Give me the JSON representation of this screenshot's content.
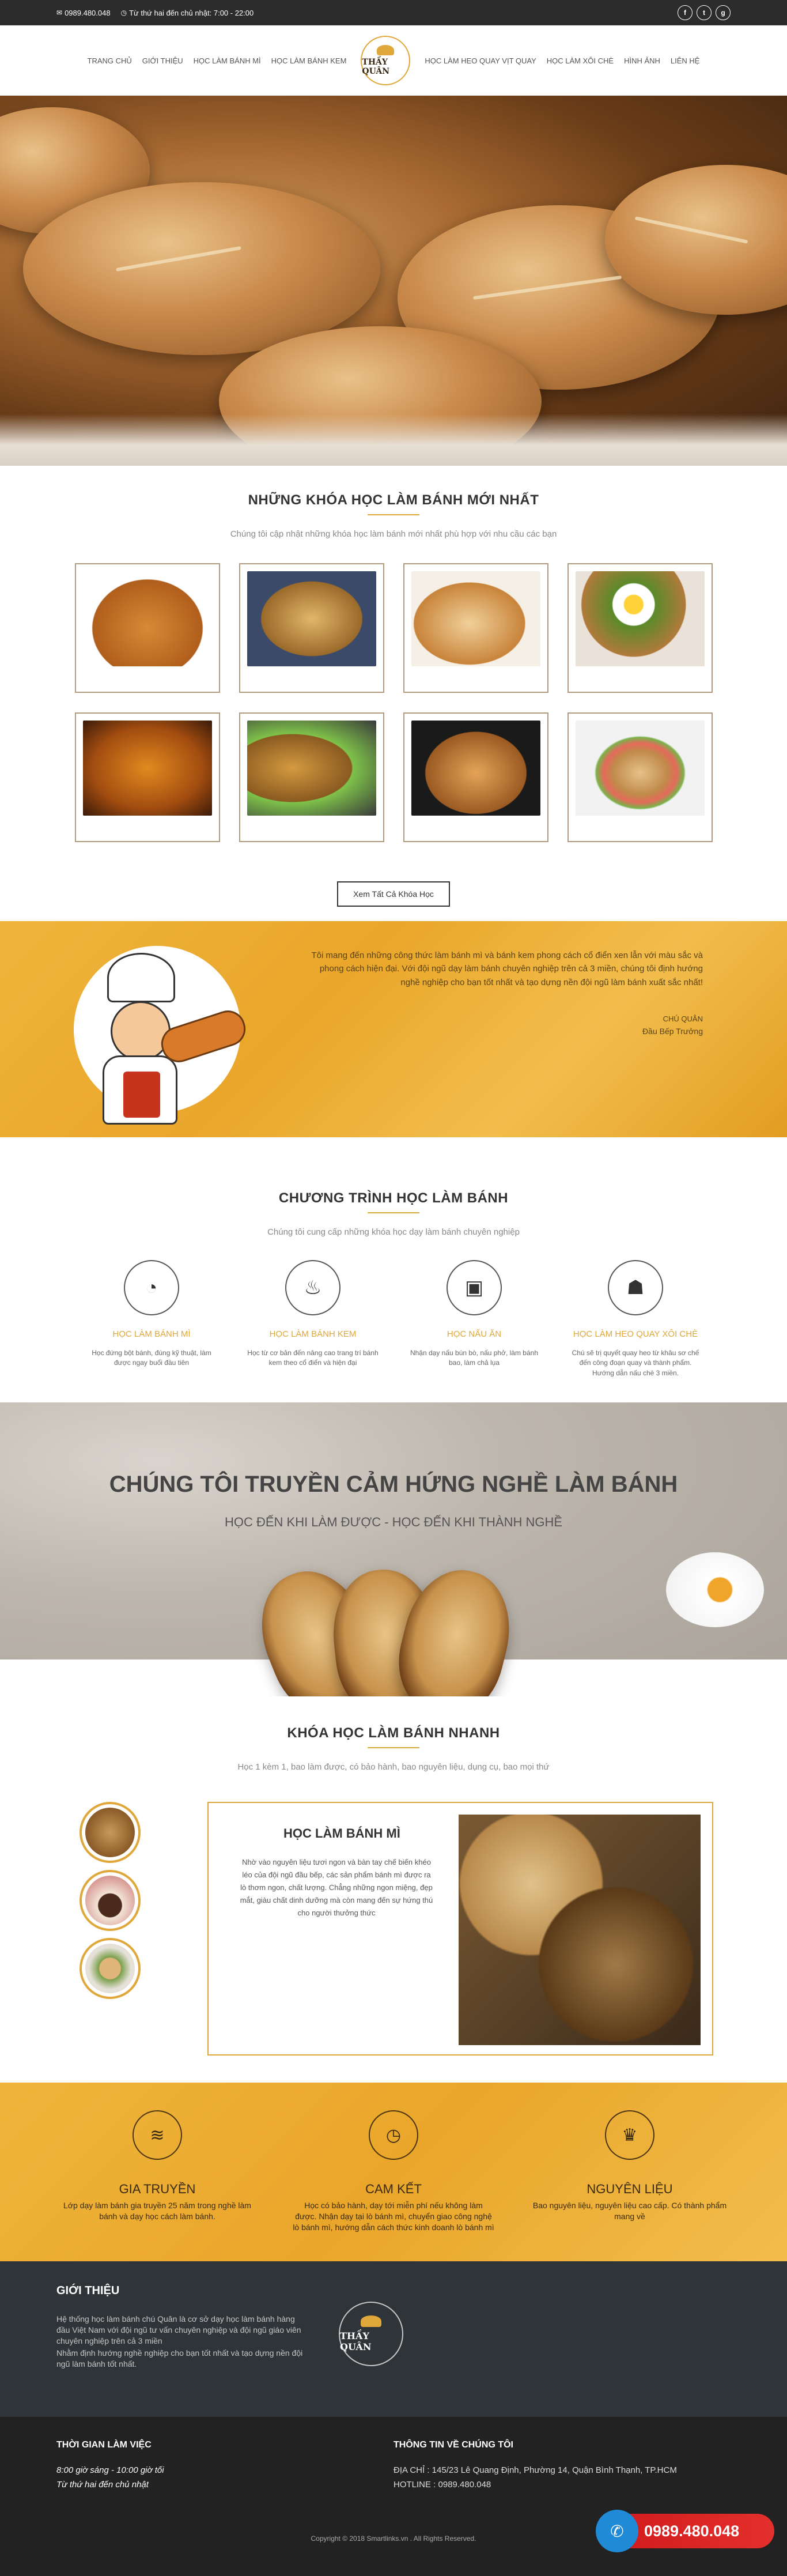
{
  "topbar": {
    "phone": "0989.480.048",
    "hours": "Từ thứ hai đến chủ nhật: 7:00 - 22:00",
    "social": [
      "f",
      "t",
      "g"
    ]
  },
  "nav": {
    "left": [
      "Trang chủ",
      "Giới thiệu",
      "Học làm bánh mì",
      "Học làm bánh kem"
    ],
    "logo": "THẦY QUÂN",
    "right": [
      "Học làm heo quay vịt quay",
      "Học làm xôi chè",
      "Hình ảnh",
      "Liên hệ"
    ]
  },
  "courses": {
    "title": "Những khóa học làm bánh mới nhất",
    "subtitle": "Chúng tôi cập nhật những khóa học làm bánh mới nhất phù hợp với nhu cầu các bạn",
    "button": "Xem Tất Cả Khóa Học"
  },
  "chef": {
    "quote": "Tôi mang đến những công thức làm bánh mì và bánh kem phong cách cổ điển xen lẫn với màu sắc và phong cách hiện đại. Với đội ngũ dạy làm bánh chuyên nghiệp trên cả 3 miền, chúng tôi định hướng nghề nghiệp cho bạn tốt nhất và tạo dựng nền đội ngũ làm bánh xuất sắc nhất!",
    "name": "Chú Quân",
    "role": "Đầu Bếp Trưởng"
  },
  "program": {
    "title": "Chương trình học làm bánh",
    "subtitle": "Chúng tôi cung cấp những khóa học dạy làm bánh chuyên nghiệp",
    "items": [
      {
        "title": "Học làm bánh mì",
        "desc": "Học đứng bột bánh, đúng kỹ thuật, làm được ngay buổi đầu tiên"
      },
      {
        "title": "Học làm bánh kem",
        "desc": "Học từ cơ bản đến nâng cao trang trí bánh kem theo cổ điển và hiện đại"
      },
      {
        "title": "Học nấu ăn",
        "desc": "Nhận dạy nấu bún bò, nấu phở, làm bánh bao, làm chả lụa"
      },
      {
        "title": "Học làm heo quay xôi chè",
        "desc": "Chú sẽ trị quyết quay heo từ khâu sơ chế đến công đoạn quay và thành phẩm. Hướng dẫn nấu chè 3 miền."
      }
    ]
  },
  "inspire": {
    "title": "Chúng tôi truyền cảm hứng nghề làm bánh",
    "subtitle": "Học đến khi làm được - Học đến khi thành nghề"
  },
  "quick": {
    "title": "Khóa học làm bánh nhanh",
    "subtitle": "Học 1 kèm 1, bao làm được, có bảo hành, bao nguyên liệu, dụng cụ, bao mọi thứ",
    "card_title": "Học làm bánh mì",
    "card_text": "Nhờ vào nguyên liệu tươi ngon và bàn tay chế biến khéo léo của đội ngũ đầu bếp, các sản phẩm bánh mì được ra lò thơm ngon, chất lượng. Chẳng những ngon miệng, đẹp mắt, giàu chất dinh dưỡng mà còn mang đến sự hứng thú cho người thưởng thức"
  },
  "values": [
    {
      "title": "Gia truyền",
      "desc": "Lớp dạy làm bánh gia truyền 25 năm trong nghề làm bánh và dạy học cách làm bánh."
    },
    {
      "title": "Cam kết",
      "desc": "Học có bảo hành, dạy tới miễn phí nếu không làm được. Nhận dạy tại lò bánh mì, chuyển giao công nghệ lò bánh mì, hướng dẫn cách thức kinh doanh lò bánh mì"
    },
    {
      "title": "Nguyên liệu",
      "desc": "Bao nguyên liệu, nguyên liệu cao cấp. Có thành phẩm mang về"
    }
  ],
  "intro": {
    "title": "Giới thiệu",
    "text": "Hệ thống học làm bánh chú Quân là cơ sở dạy học làm bánh hàng đầu Việt Nam với đội ngũ tư vấn chuyên nghiệp và đội ngũ giáo viên chuyên nghiệp trên cả 3 miền",
    "text2": "Nhằm định hướng nghề nghiệp cho bạn tốt nhất và tạo dựng nền đội ngũ làm bánh tốt nhất.",
    "logo": "THẦY QUÂN"
  },
  "footer": {
    "hours_title": "Thời gian làm việc",
    "hours1": "8:00 giờ sáng - 10:00 giờ tối",
    "hours2": "Từ thứ hai đến chủ nhật",
    "info_title": "Thông tin về chúng tôi",
    "address": "ĐỊA CHỈ : 145/23 Lê Quang Định, Phường 14, Quận Bình Thạnh, TP.HCM",
    "hotline": "HOTLINE : 0989.480.048",
    "copyright": "Copyright © 2018 Smartlinks.vn . All Rights Reserved.",
    "floating_phone": "0989.480.048"
  },
  "colors": {
    "accent": "#e0a73a",
    "dark": "#2f3438",
    "hotline": "#d0191c"
  }
}
